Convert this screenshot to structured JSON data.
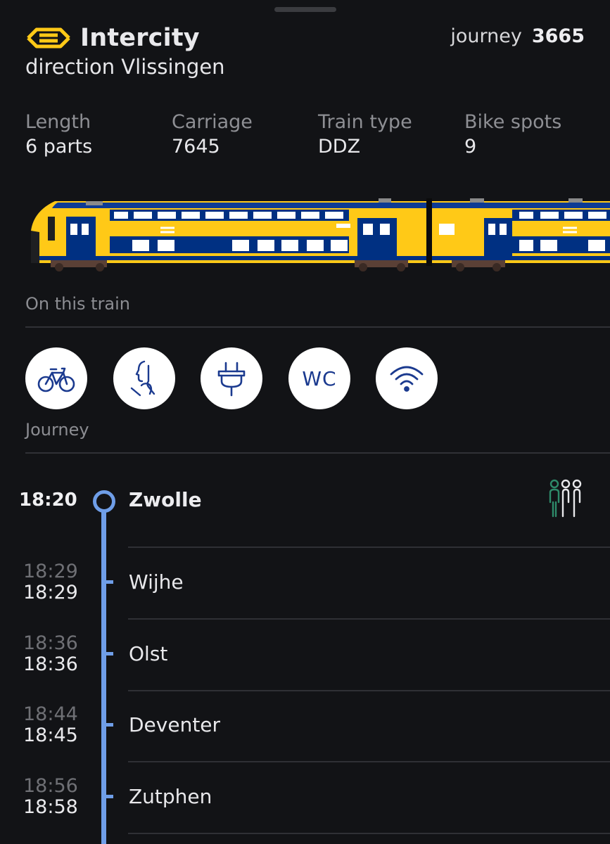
{
  "header": {
    "title": "Intercity",
    "direction": "direction Vlissingen",
    "journey_label": "journey",
    "journey_number": "3665"
  },
  "specs": [
    {
      "label": "Length",
      "value": "6  parts"
    },
    {
      "label": "Carriage",
      "value": "7645"
    },
    {
      "label": "Train type",
      "value": "DDZ"
    },
    {
      "label": "Bike spots",
      "value": "9"
    }
  ],
  "on_this_train_label": "On this train",
  "amenities": [
    {
      "icon": "bike-icon"
    },
    {
      "icon": "silence-icon"
    },
    {
      "icon": "power-plug-icon"
    },
    {
      "icon": "toilet-icon",
      "text": "WC"
    },
    {
      "icon": "wifi-icon"
    }
  ],
  "journey_label": "Journey",
  "origin": {
    "time": "18:20",
    "name": "Zwolle",
    "crowd_icon": "crowdedness-icon"
  },
  "stops": [
    {
      "scheduled": "18:29",
      "actual": "18:29",
      "name": "Wijhe"
    },
    {
      "scheduled": "18:36",
      "actual": "18:36",
      "name": "Olst"
    },
    {
      "scheduled": "18:44",
      "actual": "18:45",
      "name": "Deventer"
    },
    {
      "scheduled": "18:56",
      "actual": "18:58",
      "name": "Zutphen"
    }
  ],
  "colors": {
    "background": "#121316",
    "ns_yellow": "#ffc917",
    "ns_blue": "#003082",
    "timeline": "#6f9ee8",
    "crowd_green": "#2e8b6a"
  }
}
